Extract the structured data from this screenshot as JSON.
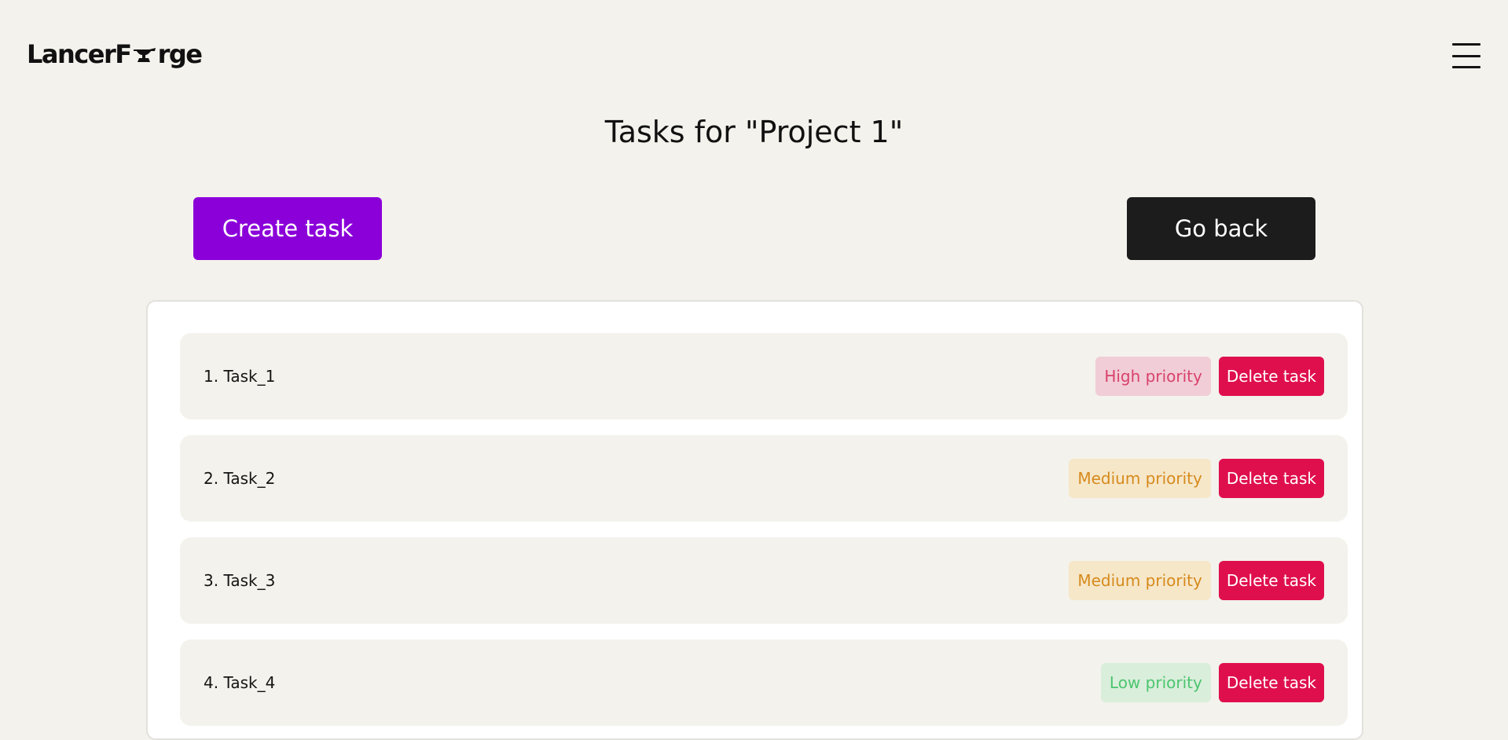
{
  "app": {
    "logo_left": "LancerF",
    "logo_right": "rge",
    "logo_icon": "anvil-icon",
    "menu_icon": "hamburger-menu-icon"
  },
  "page": {
    "title": "Tasks for \"Project 1\""
  },
  "actions": {
    "create_label": "Create task",
    "back_label": "Go back"
  },
  "colors": {
    "background": "#f3f2ec",
    "create_button": "#8b00d9",
    "back_button": "#1c1c1c",
    "delete_button": "#df0f4d",
    "high_badge_bg": "#f1cdd7",
    "high_badge_text": "#d8426b",
    "medium_badge_bg": "#f6e7c9",
    "medium_badge_text": "#d68a1c",
    "low_badge_bg": "#d9eedb",
    "low_badge_text": "#4cc56f"
  },
  "tasks": [
    {
      "label": "1. Task_1",
      "priority": "High priority",
      "delete_label": "Delete task"
    },
    {
      "label": "2. Task_2",
      "priority": "Medium priority",
      "delete_label": "Delete task"
    },
    {
      "label": "3. Task_3",
      "priority": "Medium priority",
      "delete_label": "Delete task"
    },
    {
      "label": "4. Task_4",
      "priority": "Low priority",
      "delete_label": "Delete task"
    }
  ]
}
